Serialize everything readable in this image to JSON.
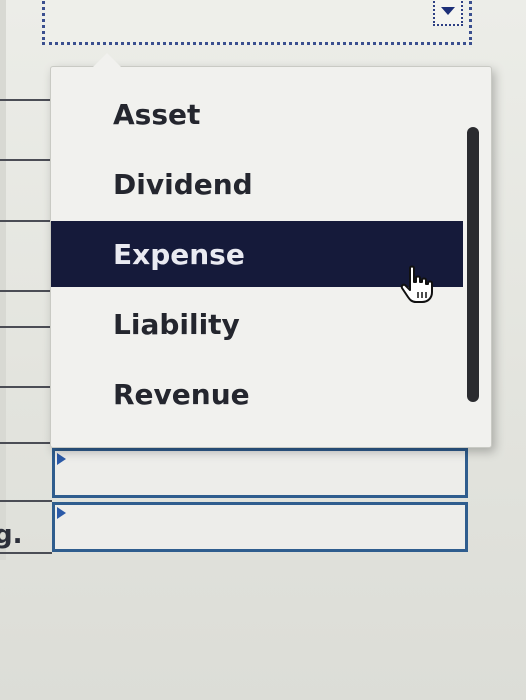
{
  "dropdown": {
    "options": [
      "Asset",
      "Dividend",
      "Expense",
      "Liability",
      "Revenue"
    ],
    "selected_index": 2,
    "selected_color": "#151a3a"
  },
  "background_text": "g.",
  "icons": {
    "select_arrow": "chevron-down-icon",
    "pointer": "hand-pointer-icon"
  }
}
